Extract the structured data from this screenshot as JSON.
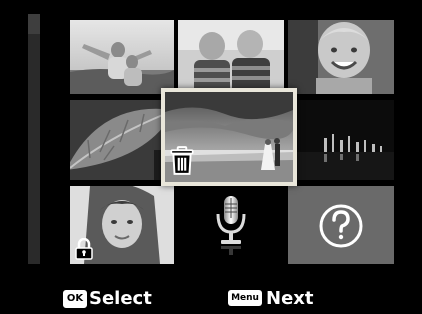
{
  "footer": {
    "ok_key": "OK",
    "select_label": "Select",
    "menu_key": "Menu",
    "next_label": "Next"
  },
  "thumbnails": [
    {
      "name": "couple-in-field"
    },
    {
      "name": "two-boys"
    },
    {
      "name": "smiling-girl"
    },
    {
      "name": "leaf-closeup"
    },
    {
      "name": "beach-couple-selected",
      "icon": "trash-icon"
    },
    {
      "name": "night-city"
    },
    {
      "name": "woman-portrait",
      "icon": "lock-icon"
    },
    {
      "name": "voice-memo",
      "icon": "microphone-icon"
    },
    {
      "name": "unknown-file",
      "icon": "question-mark-icon"
    }
  ]
}
